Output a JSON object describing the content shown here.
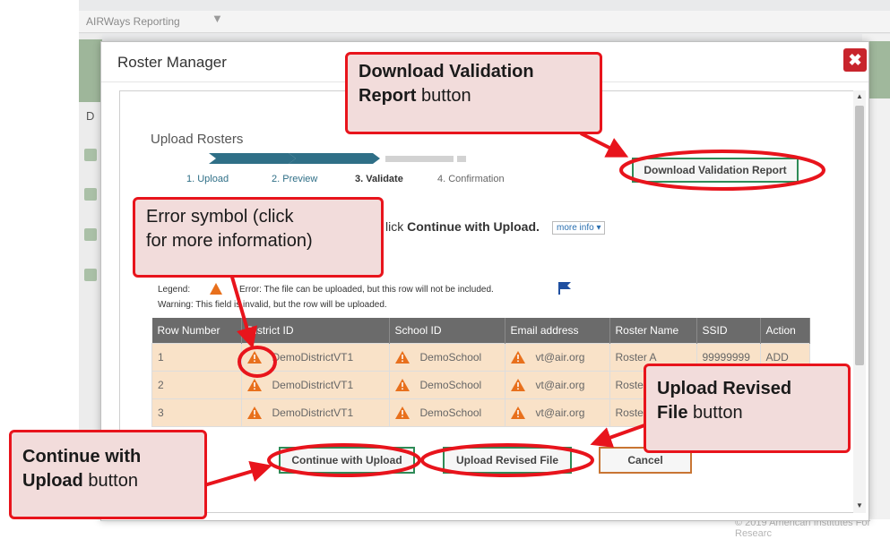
{
  "background": {
    "app_title": "AIRWays Reporting",
    "left_letter": "D",
    "footer": "© 2019 American Institutes For Researc"
  },
  "modal": {
    "title": "Roster Manager",
    "close_glyph": "✖"
  },
  "upload": {
    "section_title": "Upload Rosters",
    "steps": [
      {
        "label": "1. Upload",
        "state": "done"
      },
      {
        "label": "2. Preview",
        "state": "done"
      },
      {
        "label": "3. Validate",
        "state": "current"
      },
      {
        "label": "4. Confirmation",
        "state": "pending"
      }
    ],
    "instruction_prefix": "lick ",
    "instruction_bold": "Continue with Upload.",
    "more_info": "more info ▾",
    "legend_line1_prefix": "Legend:",
    "legend_line1_text": "Error: The file can be uploaded, but this row will not be included.",
    "legend_line2": "Warning: This field is invalid, but the row will be uploaded."
  },
  "table": {
    "headers": [
      "Row Number",
      "District ID",
      "School ID",
      "Email address",
      "Roster Name",
      "SSID",
      "Action"
    ],
    "rows": [
      [
        "1",
        "DemoDistrictVT1",
        "DemoSchool",
        "vt@air.org",
        "Roster A",
        "99999999",
        "ADD"
      ],
      [
        "2",
        "DemoDistrictVT1",
        "DemoSchool",
        "vt@air.org",
        "Roste",
        "",
        ""
      ],
      [
        "3",
        "DemoDistrictVT1",
        "DemoSchool",
        "vt@air.org",
        "Roste",
        "",
        ""
      ]
    ]
  },
  "buttons": {
    "download_validation": "Download Validation Report",
    "continue_upload": "Continue with Upload",
    "upload_revised": "Upload Revised File",
    "cancel": "Cancel"
  },
  "callouts": {
    "download": {
      "bold": "Download Validation",
      "bold2": "Report",
      "rest": " button"
    },
    "error_symbol": {
      "line1": "Error symbol (click",
      "line2": "for more information)"
    },
    "upload_revised": {
      "bold": "Upload Revised",
      "bold2": "File",
      "rest": " button"
    },
    "continue": {
      "bold": "Continue with",
      "bold2": "Upload",
      "rest": " button"
    }
  },
  "colors": {
    "callout_border": "#e8141c",
    "callout_fill": "#f2dcdb",
    "row_fill": "#f9e2c8",
    "header_fill": "#6b6b6b",
    "step_done": "#2f6f87",
    "close_red": "#c8242c"
  }
}
